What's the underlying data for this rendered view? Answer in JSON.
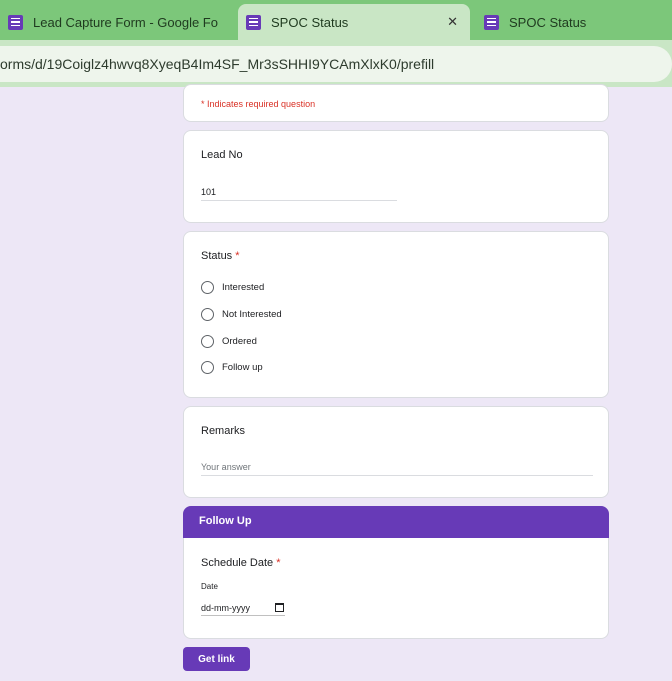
{
  "browser": {
    "tabs": [
      {
        "label": "Lead Capture Form - Google Fo"
      },
      {
        "label": "SPOC Status"
      },
      {
        "label": "SPOC Status"
      }
    ],
    "close_glyph": "✕",
    "url": "orms/d/19Coiglz4hwvq8XyeqB4Im4SF_Mr3sSHHI9YCAmXlxK0/prefill"
  },
  "form": {
    "required_note": "* Indicates required question",
    "lead_no": {
      "label": "Lead No",
      "value": "101"
    },
    "status": {
      "label": "Status",
      "required_mark": "*",
      "options": [
        "Interested",
        "Not Interested",
        "Ordered",
        "Follow up"
      ]
    },
    "remarks": {
      "label": "Remarks",
      "placeholder": "Your answer"
    },
    "follow_up": {
      "section_title": "Follow Up",
      "schedule_date": {
        "label": "Schedule Date",
        "required_mark": "*",
        "sub_label": "Date",
        "placeholder": "dd-mm-yyyy"
      }
    },
    "get_link_label": "Get link"
  },
  "colors": {
    "accent": "#673ab7",
    "background": "#ede7f6",
    "required": "#d93025",
    "tabbar": "#7cc77a"
  }
}
